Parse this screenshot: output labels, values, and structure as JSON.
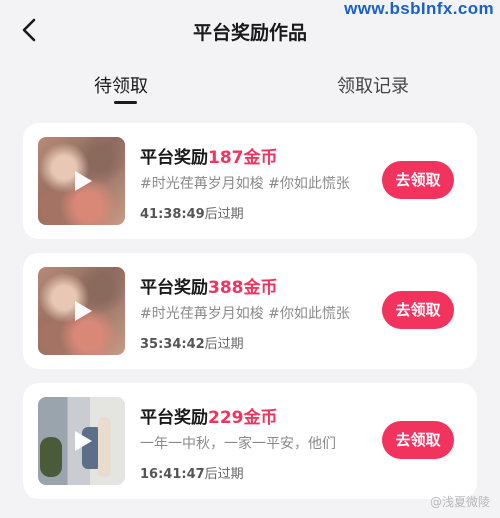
{
  "watermark_top": "www.bsbInfx.com",
  "header": {
    "title": "平台奖励作品"
  },
  "tabs": [
    {
      "label": "待领取",
      "active": true
    },
    {
      "label": "领取记录",
      "active": false
    }
  ],
  "items": [
    {
      "reward_prefix": "平台奖励",
      "reward_amount": "187金币",
      "tags": "#时光荏苒岁月如梭 #你如此慌张",
      "time_left": "41:38:49",
      "expire_suffix": "后过期",
      "button_label": "去领取",
      "thumb_icon": "play-icon"
    },
    {
      "reward_prefix": "平台奖励",
      "reward_amount": "388金币",
      "tags": "#时光荏苒岁月如梭 #你如此慌张",
      "time_left": "35:34:42",
      "expire_suffix": "后过期",
      "button_label": "去领取",
      "thumb_icon": "play-icon"
    },
    {
      "reward_prefix": "平台奖励",
      "reward_amount": "229金币",
      "tags": "一年一中秋，一家一平安，他们",
      "time_left": "16:41:47",
      "expire_suffix": "后过期",
      "button_label": "去领取",
      "thumb_icon": "play-icon"
    }
  ],
  "watermark_bottom": "@浅夏微陵",
  "colors": {
    "accent": "#f2335e",
    "background": "#f3f3f5",
    "card": "#ffffff"
  }
}
